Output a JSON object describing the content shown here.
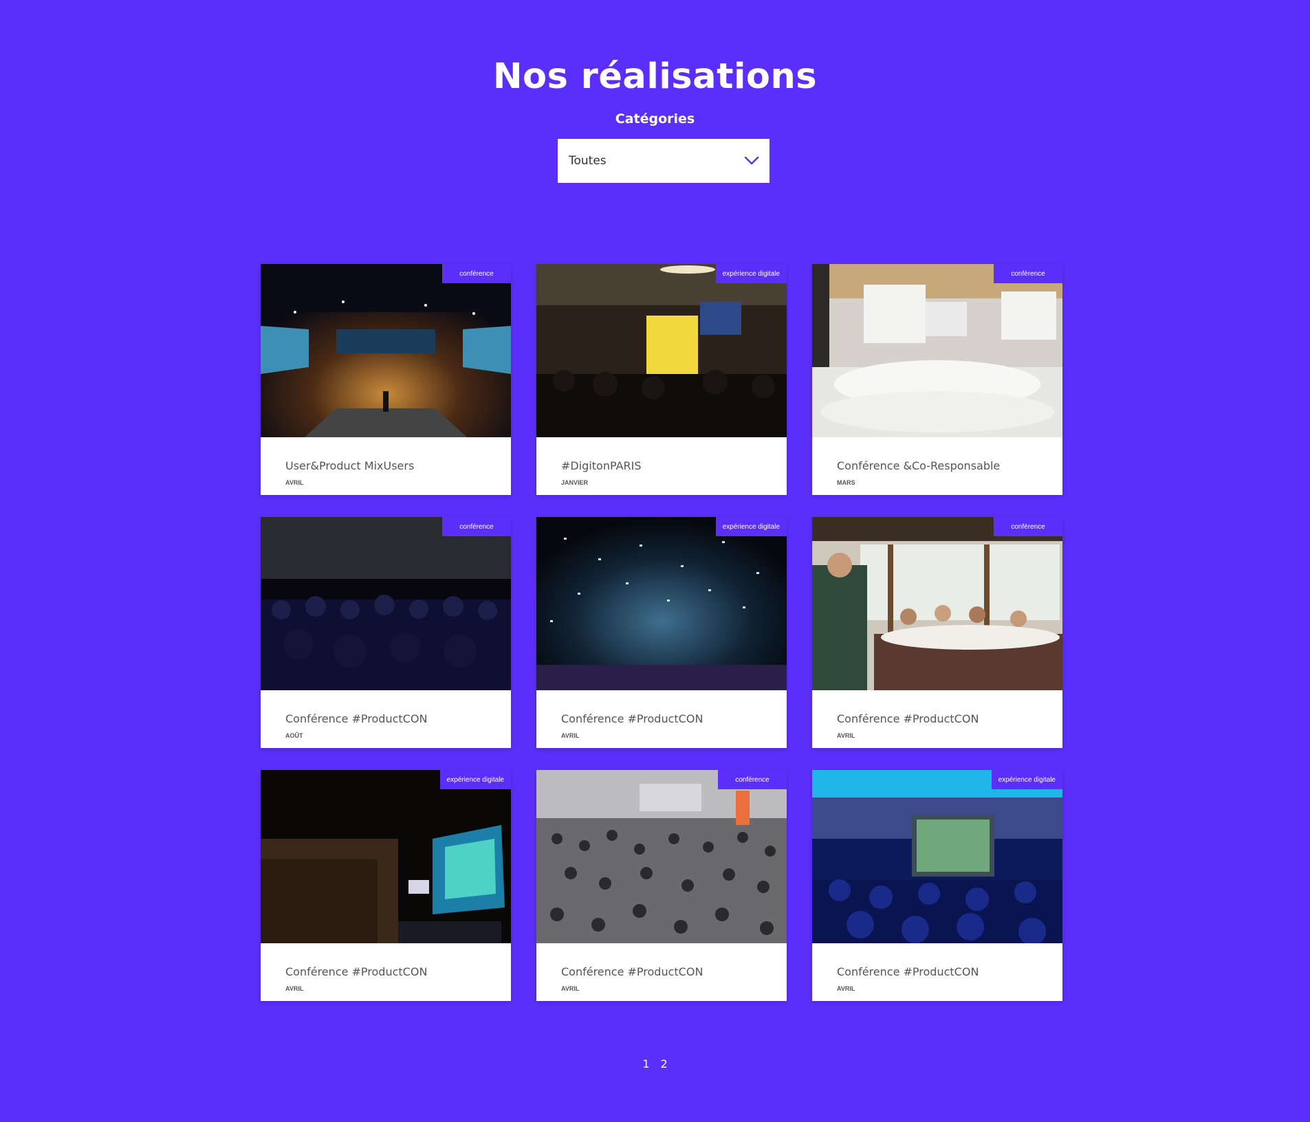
{
  "page": {
    "title": "Nos réalisations",
    "filter_label": "Catégories",
    "filter_value": "Toutes"
  },
  "colors": {
    "background": "#5b2ff9",
    "tag_background": "#5b2ff9",
    "card_background": "#ffffff"
  },
  "cards": [
    {
      "tag": "conférence",
      "title": "User&Product MixUsers",
      "month": "AVRIL",
      "image": "conference-hall-stage-photo"
    },
    {
      "tag": "expérience digitale",
      "title": "#DigitonPARIS",
      "month": "JANVIER",
      "image": "audience-yellow-screen-photo"
    },
    {
      "tag": "conférence",
      "title": "Conférence &Co-Responsable",
      "month": "MARS",
      "image": "white-conference-room-photo"
    },
    {
      "tag": "conférence",
      "title": "Conférence #ProductCON",
      "month": "AOÛT",
      "image": "dark-audience-photo"
    },
    {
      "tag": "expérience digitale",
      "title": "Conférence #ProductCON",
      "month": "AVRIL",
      "image": "confetti-concert-photo"
    },
    {
      "tag": "conférence",
      "title": "Conférence #ProductCON",
      "month": "AVRIL",
      "image": "speaker-dinner-table-photo"
    },
    {
      "tag": "expérience digitale",
      "title": "Conférence #ProductCON",
      "month": "AVRIL",
      "image": "theater-stage-screen-photo"
    },
    {
      "tag": "conférence",
      "title": "Conférence #ProductCON",
      "month": "AVRIL",
      "image": "crowded-expo-photo"
    },
    {
      "tag": "expérience digitale",
      "title": "Conférence #ProductCON",
      "month": "AVRIL",
      "image": "blue-lit-presentation-photo"
    }
  ],
  "pagination": [
    "1",
    "2"
  ]
}
